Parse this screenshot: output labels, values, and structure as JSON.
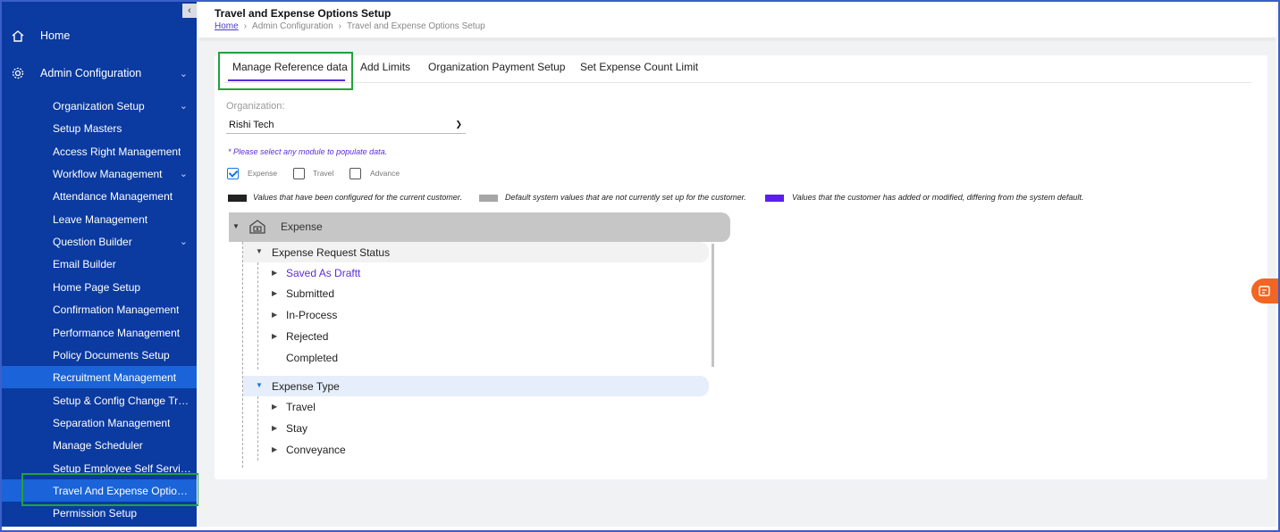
{
  "header": {
    "title": "Travel and Expense Options Setup",
    "breadcrumb": [
      "Home",
      "Admin Configuration",
      "Travel and Expense Options Setup"
    ],
    "separator": "›"
  },
  "sidebar": {
    "collapse": "‹",
    "home": "Home",
    "admin": "Admin Configuration",
    "items": [
      {
        "label": "Organization Setup",
        "chev": "⌄"
      },
      {
        "label": "Setup Masters"
      },
      {
        "label": "Access Right Management"
      },
      {
        "label": "Workflow Management",
        "chev": "⌄"
      },
      {
        "label": "Attendance Management"
      },
      {
        "label": "Leave Management"
      },
      {
        "label": "Question Builder",
        "chev": "⌄"
      },
      {
        "label": "Email Builder"
      },
      {
        "label": "Home Page Setup"
      },
      {
        "label": "Confirmation Management"
      },
      {
        "label": "Performance Management"
      },
      {
        "label": "Policy Documents Setup"
      },
      {
        "label": "Recruitment Management"
      },
      {
        "label": "Setup & Config Change Trac..."
      },
      {
        "label": "Separation Management"
      },
      {
        "label": "Manage Scheduler"
      },
      {
        "label": "Setup Employee Self Service"
      },
      {
        "label": "Travel And Expense Option..."
      },
      {
        "label": "Permission Setup"
      }
    ],
    "active_index": 17
  },
  "tabs": [
    "Manage Reference data",
    "Add Limits",
    "Organization Payment Setup",
    "Set Expense Count Limit"
  ],
  "form": {
    "org_label": "Organization:",
    "org_value": "Rishi Tech",
    "note": "* Please select any module to populate data.",
    "modules": [
      {
        "label": "Expense",
        "checked": true
      },
      {
        "label": "Travel",
        "checked": false
      },
      {
        "label": "Advance",
        "checked": false
      }
    ]
  },
  "legend": [
    {
      "color": "#222222",
      "text": "Values that have been configured for the current customer."
    },
    {
      "color": "#a6a6a6",
      "text": "Default system values that are not currently set up for the customer."
    },
    {
      "color": "#5a1ff0",
      "text": "Values that the customer has added or modified, differing from the system default."
    }
  ],
  "tree": {
    "root": "Expense",
    "groups": [
      {
        "label": "Expense Request Status",
        "items": [
          {
            "label": "Saved As Draftt",
            "custom": true,
            "arrow": true
          },
          {
            "label": "Submitted",
            "arrow": true
          },
          {
            "label": "In-Process",
            "arrow": true
          },
          {
            "label": "Rejected",
            "arrow": true
          },
          {
            "label": "Completed",
            "arrow": false
          }
        ]
      },
      {
        "label": "Expense Type",
        "items": [
          {
            "label": "Travel",
            "arrow": true
          },
          {
            "label": "Stay",
            "arrow": true
          },
          {
            "label": "Conveyance",
            "arrow": true
          }
        ]
      }
    ]
  },
  "icons": {
    "home": "home-icon",
    "gear": "gear-icon",
    "feedback": "feedback-icon"
  }
}
